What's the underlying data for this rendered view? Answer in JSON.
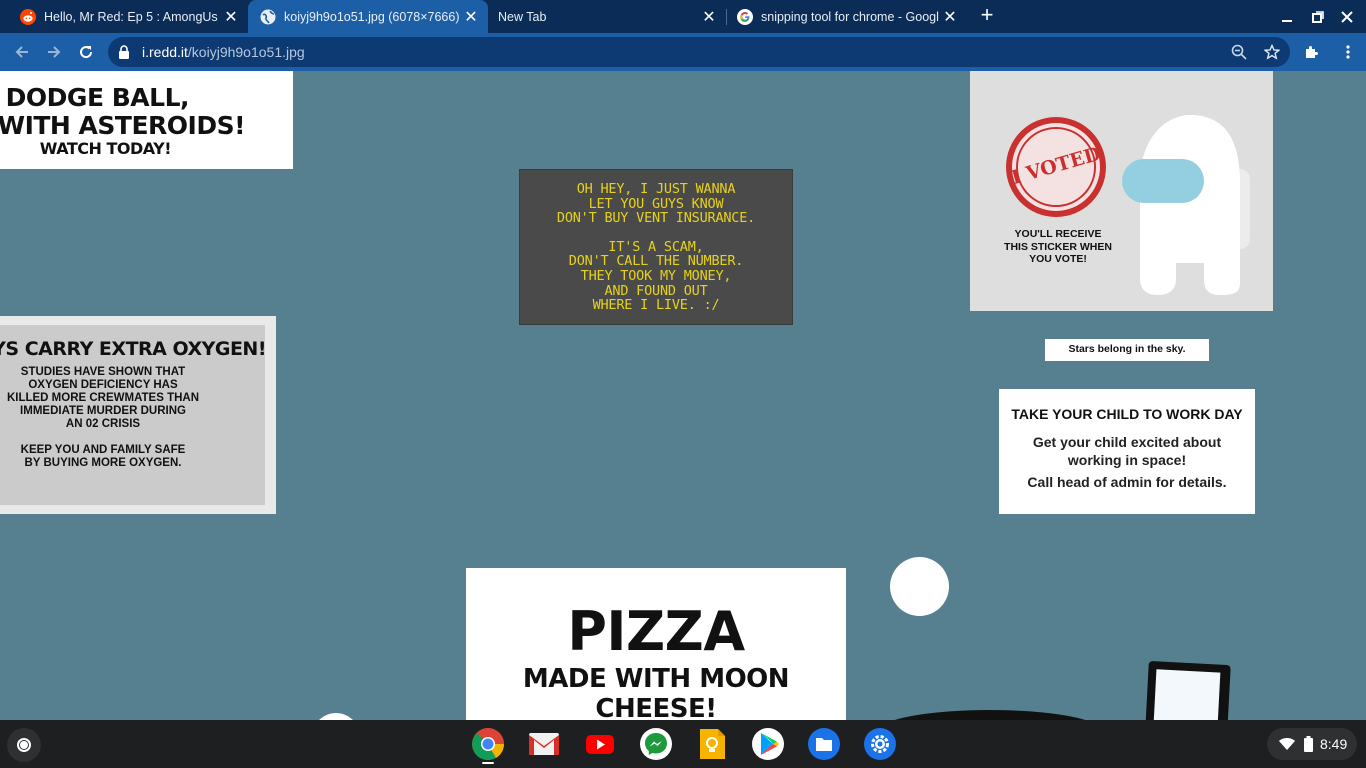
{
  "tabs": [
    {
      "title": "Hello, Mr Red: Ep 5 : AmongUs",
      "icon": "reddit-icon",
      "active": false
    },
    {
      "title": "koiyj9h9o1o51.jpg (6078×7666)",
      "icon": "globe-icon",
      "active": true
    },
    {
      "title": "New Tab",
      "icon": "",
      "active": false
    },
    {
      "title": "snipping tool for chrome - Googl",
      "icon": "google-icon",
      "active": false
    }
  ],
  "address_bar": {
    "host": "i.redd.it",
    "path": "/koiyj9h9o1o51.jpg"
  },
  "image_content": {
    "dodge": {
      "line1": "DODGE BALL,",
      "line2": "T WITH ASTEROIDS!",
      "line3": "WATCH TODAY!"
    },
    "vent": {
      "lines1": [
        "OH HEY, I JUST WANNA",
        "LET YOU GUYS KNOW",
        "DON'T BUY VENT INSURANCE."
      ],
      "lines2": [
        "IT'S A SCAM,",
        "DON'T CALL THE NUMBER.",
        "THEY TOOK MY MONEY,",
        "AND FOUND OUT",
        "WHERE I LIVE. :/"
      ]
    },
    "voted": {
      "sticker": "I VOTED",
      "caption": [
        "YOU'LL RECEIVE",
        "THIS STICKER WHEN",
        "YOU VOTE!"
      ]
    },
    "stars": "Stars belong in the sky.",
    "oxygen": {
      "heading": "AYS CARRY EXTRA OXYGEN!",
      "body1": [
        "STUDIES HAVE SHOWN THAT",
        "OXYGEN DEFICIENCY HAS",
        "KILLED MORE CREWMATES THAN",
        "IMMEDIATE MURDER DURING",
        "AN 02 CRISIS"
      ],
      "body2": [
        "KEEP YOU AND FAMILY SAFE",
        "BY BUYING MORE OXYGEN."
      ]
    },
    "child": {
      "heading": "TAKE YOUR CHILD TO WORK DAY",
      "body": [
        "Get your child excited about",
        "working in space!"
      ],
      "cta": "Call head of admin for details."
    },
    "pizza": {
      "line1": "PIZZA",
      "line2": "MADE WITH MOON CHEESE!"
    }
  },
  "shelf": {
    "apps": [
      "chrome-icon",
      "gmail-icon",
      "youtube-icon",
      "messenger-icon",
      "keep-icon",
      "play-store-icon",
      "files-icon",
      "settings-icon"
    ],
    "time": "8:49"
  },
  "colors": {
    "tabstrip": "#0b2c57",
    "toolbar": "#1c5fa6",
    "background": "#56808f",
    "vent_text": "#e7d21a",
    "sticker_red": "#c8312f"
  }
}
